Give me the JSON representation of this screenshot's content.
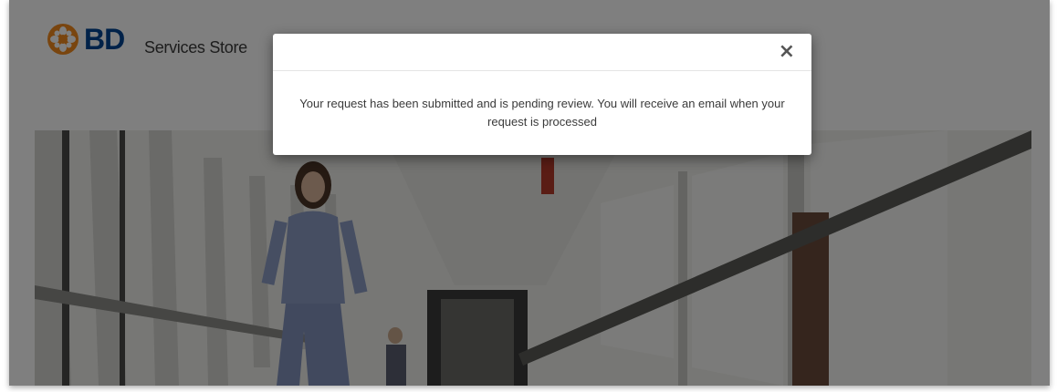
{
  "brand": {
    "logo_text": "BD",
    "store_name": "Services Store",
    "logo_color": "#004593",
    "logo_mark_color": "#f28a1e"
  },
  "modal": {
    "close_label": "×",
    "message": "Your request has been submitted and is pending review. You will receive an email when your request is processed"
  },
  "hero": {
    "icon": "hallway-photo"
  }
}
